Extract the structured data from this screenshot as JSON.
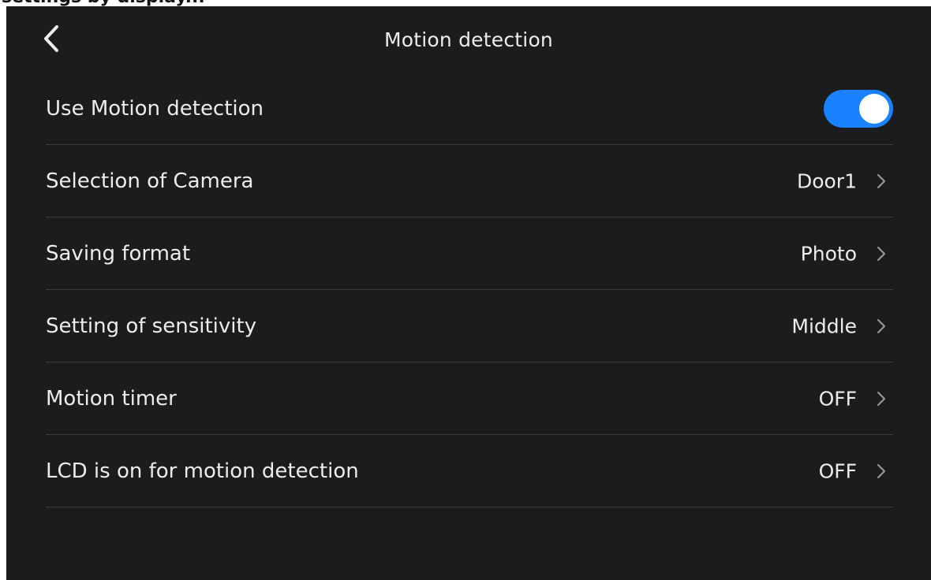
{
  "header": {
    "clipped_text": "settings by display..."
  },
  "topbar": {
    "title": "Motion detection",
    "back_icon": "chevron-left-icon"
  },
  "settings": {
    "use_motion_detection": {
      "label": "Use Motion detection",
      "enabled": true,
      "accent_color": "#1a82ff"
    },
    "camera": {
      "label": "Selection of Camera",
      "value": "Door1"
    },
    "saving_format": {
      "label": "Saving format",
      "value": "Photo"
    },
    "sensitivity": {
      "label": "Setting of sensitivity",
      "value": "Middle"
    },
    "motion_timer": {
      "label": "Motion timer",
      "value": "OFF"
    },
    "lcd_on": {
      "label": "LCD is on for motion detection",
      "value": "OFF"
    }
  },
  "colors": {
    "background": "#1b1c1e",
    "text": "#ececec",
    "divider": "#3a3b3e"
  }
}
